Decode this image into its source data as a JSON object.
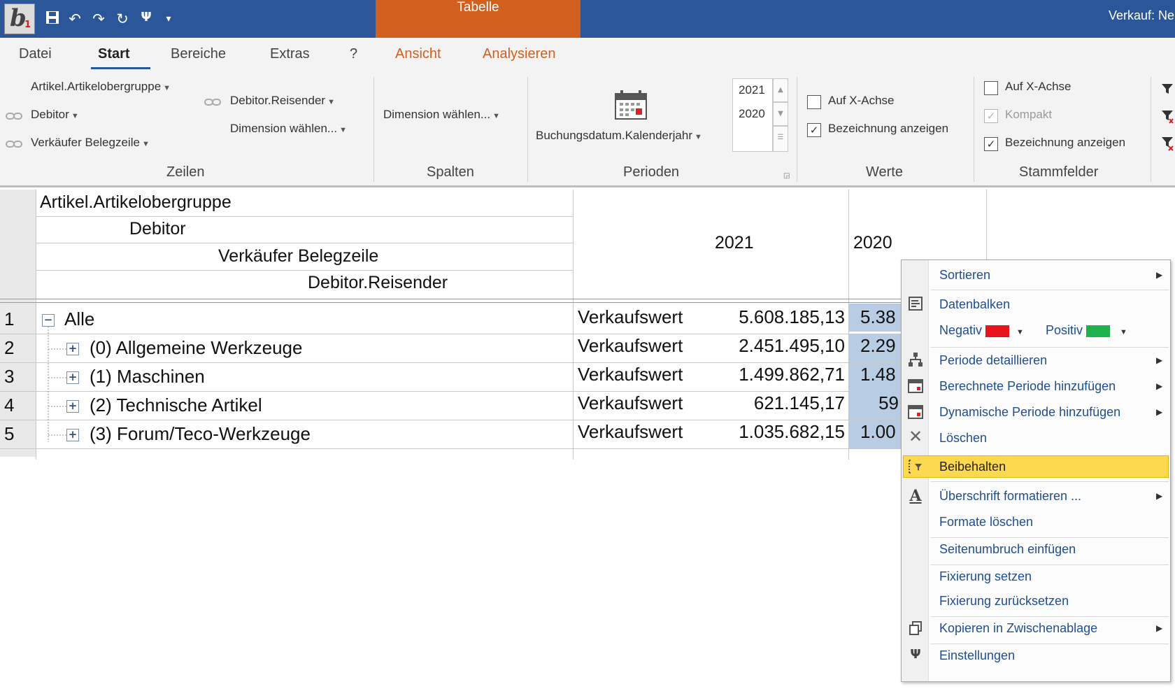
{
  "titlebar": {
    "app_logo_letter": "b",
    "app_logo_sub": "1",
    "context_tab": "Tabelle",
    "window_title": "Verkauf: Ne",
    "colors": {
      "titlebar": "#2b579a",
      "context_tab": "#d35f1f"
    }
  },
  "qat": {
    "icons": [
      "save-icon",
      "undo-icon",
      "redo-icon",
      "refresh-icon",
      "settings-icon",
      "dropdown-icon"
    ]
  },
  "tabs": [
    {
      "label": "Datei"
    },
    {
      "label": "Start"
    },
    {
      "label": "Bereiche"
    },
    {
      "label": "Extras"
    },
    {
      "label": "?"
    },
    {
      "label": "Ansicht"
    },
    {
      "label": "Analysieren"
    }
  ],
  "ribbon": {
    "zeilen": {
      "label": "Zeilen",
      "artikelobergruppe": "Artikel.Artikelobergruppe",
      "debitor": "Debitor",
      "verkaeufer": "Verkäufer Belegzeile",
      "reisender": "Debitor.Reisender",
      "dimension": "Dimension wählen..."
    },
    "spalten": {
      "label": "Spalten",
      "dimension": "Dimension wählen..."
    },
    "perioden": {
      "label": "Perioden",
      "field": "Buchungsdatum.Kalenderjahr",
      "years": [
        "2021",
        "2020"
      ]
    },
    "werte": {
      "label": "Werte",
      "auf_x_achse": {
        "label": "Auf X-Achse",
        "checked": false
      },
      "bezeichnung": {
        "label": "Bezeichnung anzeigen",
        "checked": true
      }
    },
    "stammfelder": {
      "label": "Stammfelder",
      "auf_x_achse": {
        "label": "Auf X-Achse",
        "checked": false
      },
      "kompakt": {
        "label": "Kompakt",
        "checked": true,
        "disabled": true
      },
      "bezeichnung": {
        "label": "Bezeichnung anzeigen",
        "checked": true
      }
    }
  },
  "grid": {
    "header_levels": [
      "Artikel.Artikelobergruppe",
      "Debitor",
      "Verkäufer Belegzeile",
      "Debitor.Reisender"
    ],
    "column_years": [
      "2021",
      "2020"
    ],
    "rows": [
      {
        "num": "1",
        "label": "Alle",
        "expander": "−",
        "measure": "Verkaufswert",
        "v2021": "5.608.185,13",
        "v2020": "5.38"
      },
      {
        "num": "2",
        "label": "(0) Allgemeine Werkzeuge",
        "expander": "+",
        "measure": "Verkaufswert",
        "v2021": "2.451.495,10",
        "v2020": "2.29"
      },
      {
        "num": "3",
        "label": "(1) Maschinen",
        "expander": "+",
        "measure": "Verkaufswert",
        "v2021": "1.499.862,71",
        "v2020": "1.48"
      },
      {
        "num": "4",
        "label": "(2) Technische Artikel",
        "expander": "+",
        "measure": "Verkaufswert",
        "v2021": "621.145,17",
        "v2020": "59"
      },
      {
        "num": "5",
        "label": "(3) Forum/Teco-Werkzeuge",
        "expander": "+",
        "measure": "Verkaufswert",
        "v2021": "1.035.682,15",
        "v2020": "1.00"
      }
    ]
  },
  "context_menu": {
    "sortieren": "Sortieren",
    "datenbalken": "Datenbalken",
    "negativ": "Negativ",
    "positiv": "Positiv",
    "negativ_color": "#e8141c",
    "positiv_color": "#1fb14b",
    "periode_detaillieren": "Periode detaillieren",
    "berechnete_periode": "Berechnete Periode hinzufügen",
    "dynamische_periode": "Dynamische Periode hinzufügen",
    "loeschen": "Löschen",
    "beibehalten": "Beibehalten",
    "ueberschrift": "Überschrift formatieren ...",
    "formate_loeschen": "Formate löschen",
    "seitenumbruch": "Seitenumbruch einfügen",
    "fixierung_setzen": "Fixierung setzen",
    "fixierung_zuruecksetzen": "Fixierung zurücksetzen",
    "kopieren": "Kopieren in Zwischenablage",
    "einstellungen": "Einstellungen",
    "highlight_color": "#fdd94f"
  }
}
